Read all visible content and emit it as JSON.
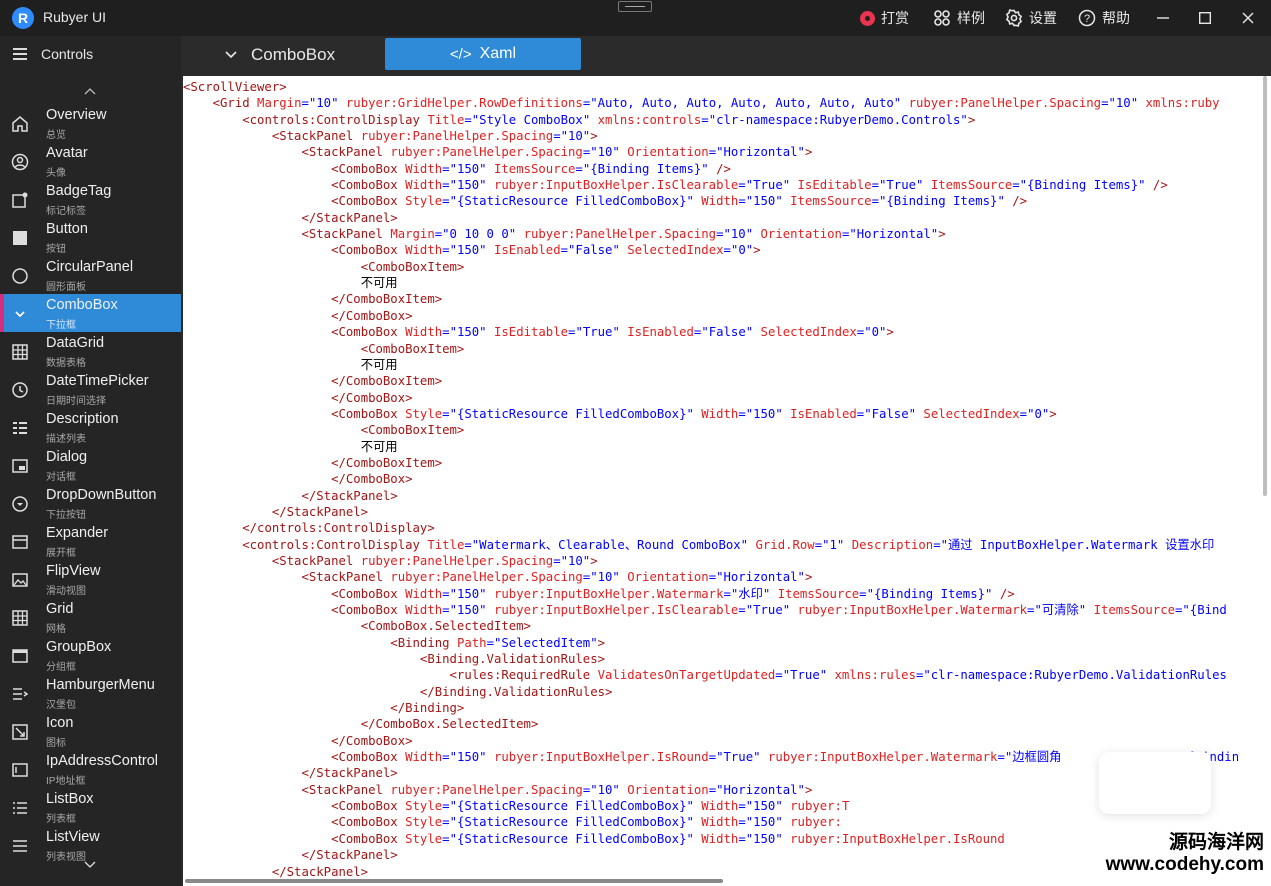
{
  "window": {
    "title": "Rubyer UI",
    "logo_letter": "R",
    "toolbar": [
      {
        "key": "reward",
        "label": "打赏",
        "icon": "reward-icon"
      },
      {
        "key": "samples",
        "label": "样例",
        "icon": "grid-icon"
      },
      {
        "key": "settings",
        "label": "设置",
        "icon": "gear-icon"
      },
      {
        "key": "help",
        "label": "帮助",
        "icon": "help-icon"
      }
    ],
    "controls": {
      "minimize": "—",
      "maximize": "☐",
      "close": "✕"
    }
  },
  "sidebar": {
    "header": "Controls",
    "items": [
      {
        "title": "Overview",
        "sub": "总览",
        "icon": "home-icon"
      },
      {
        "title": "Avatar",
        "sub": "头像",
        "icon": "avatar-icon"
      },
      {
        "title": "BadgeTag",
        "sub": "标记标签",
        "icon": "badge-icon"
      },
      {
        "title": "Button",
        "sub": "按钮",
        "icon": "button-icon"
      },
      {
        "title": "CircularPanel",
        "sub": "圆形面板",
        "icon": "circle-icon"
      },
      {
        "title": "ComboBox",
        "sub": "下拉框",
        "icon": "chevron-down-icon",
        "active": true
      },
      {
        "title": "DataGrid",
        "sub": "数据表格",
        "icon": "table-icon"
      },
      {
        "title": "DateTimePicker",
        "sub": "日期时间选择",
        "icon": "clock-icon"
      },
      {
        "title": "Description",
        "sub": "描述列表",
        "icon": "list-icon"
      },
      {
        "title": "Dialog",
        "sub": "对话框",
        "icon": "dialog-icon"
      },
      {
        "title": "DropDownButton",
        "sub": "下拉按钮",
        "icon": "dropdown-icon"
      },
      {
        "title": "Expander",
        "sub": "展开框",
        "icon": "expander-icon"
      },
      {
        "title": "FlipView",
        "sub": "滑动视图",
        "icon": "image-icon"
      },
      {
        "title": "Grid",
        "sub": "网格",
        "icon": "grid-icon"
      },
      {
        "title": "GroupBox",
        "sub": "分组框",
        "icon": "groupbox-icon"
      },
      {
        "title": "HamburgerMenu",
        "sub": "汉堡包",
        "icon": "menu-icon"
      },
      {
        "title": "Icon",
        "sub": "图标",
        "icon": "icon-icon"
      },
      {
        "title": "IpAddressControl",
        "sub": "IP地址框",
        "icon": "ip-icon"
      },
      {
        "title": "ListBox",
        "sub": "列表框",
        "icon": "listbox-icon"
      },
      {
        "title": "ListView",
        "sub": "列表视图",
        "icon": "listview-icon"
      }
    ]
  },
  "tabs": {
    "combo_label": "ComboBox",
    "xaml_label": "Xaml",
    "xaml_icon": "</>"
  },
  "code": [
    [
      [
        "t",
        "<ScrollViewer>"
      ]
    ],
    [
      [
        "s",
        "    "
      ],
      [
        "t",
        "<Grid "
      ],
      [
        "a",
        "Margin"
      ],
      [
        "p",
        "="
      ],
      [
        "v",
        "\"10\" "
      ],
      [
        "a",
        "rubyer:GridHelper.RowDefinitions"
      ],
      [
        "p",
        "="
      ],
      [
        "v",
        "\"Auto, Auto, Auto, Auto, Auto, Auto, Auto\" "
      ],
      [
        "a",
        "rubyer:PanelHelper.Spacing"
      ],
      [
        "p",
        "="
      ],
      [
        "v",
        "\"10\" "
      ],
      [
        "a",
        "xmlns:ruby"
      ]
    ],
    [
      [
        "s",
        "        "
      ],
      [
        "t",
        "<controls:ControlDisplay "
      ],
      [
        "a",
        "Title"
      ],
      [
        "p",
        "="
      ],
      [
        "v",
        "\"Style ComboBox\" "
      ],
      [
        "a",
        "xmlns:controls"
      ],
      [
        "p",
        "="
      ],
      [
        "v",
        "\"clr-namespace:RubyerDemo.Controls\""
      ],
      [
        "t",
        ">"
      ]
    ],
    [
      [
        "s",
        "            "
      ],
      [
        "t",
        "<StackPanel "
      ],
      [
        "a",
        "rubyer:PanelHelper.Spacing"
      ],
      [
        "p",
        "="
      ],
      [
        "v",
        "\"10\""
      ],
      [
        "t",
        ">"
      ]
    ],
    [
      [
        "s",
        "                "
      ],
      [
        "t",
        "<StackPanel "
      ],
      [
        "a",
        "rubyer:PanelHelper.Spacing"
      ],
      [
        "p",
        "="
      ],
      [
        "v",
        "\"10\" "
      ],
      [
        "a",
        "Orientation"
      ],
      [
        "p",
        "="
      ],
      [
        "v",
        "\"Horizontal\""
      ],
      [
        "t",
        ">"
      ]
    ],
    [
      [
        "s",
        "                    "
      ],
      [
        "t",
        "<ComboBox "
      ],
      [
        "a",
        "Width"
      ],
      [
        "p",
        "="
      ],
      [
        "v",
        "\"150\" "
      ],
      [
        "a",
        "ItemsSource"
      ],
      [
        "p",
        "="
      ],
      [
        "v",
        "\"{Binding Items}\" "
      ],
      [
        "t",
        "/>"
      ]
    ],
    [
      [
        "s",
        "                    "
      ],
      [
        "t",
        "<ComboBox "
      ],
      [
        "a",
        "Width"
      ],
      [
        "p",
        "="
      ],
      [
        "v",
        "\"150\" "
      ],
      [
        "a",
        "rubyer:InputBoxHelper.IsClearable"
      ],
      [
        "p",
        "="
      ],
      [
        "v",
        "\"True\" "
      ],
      [
        "a",
        "IsEditable"
      ],
      [
        "p",
        "="
      ],
      [
        "v",
        "\"True\" "
      ],
      [
        "a",
        "ItemsSource"
      ],
      [
        "p",
        "="
      ],
      [
        "v",
        "\"{Binding Items}\" "
      ],
      [
        "t",
        "/>"
      ]
    ],
    [
      [
        "s",
        "                    "
      ],
      [
        "t",
        "<ComboBox "
      ],
      [
        "a",
        "Style"
      ],
      [
        "p",
        "="
      ],
      [
        "v",
        "\"{StaticResource FilledComboBox}\" "
      ],
      [
        "a",
        "Width"
      ],
      [
        "p",
        "="
      ],
      [
        "v",
        "\"150\" "
      ],
      [
        "a",
        "ItemsSource"
      ],
      [
        "p",
        "="
      ],
      [
        "v",
        "\"{Binding Items}\" "
      ],
      [
        "t",
        "/>"
      ]
    ],
    [
      [
        "s",
        "                "
      ],
      [
        "t",
        "</StackPanel>"
      ]
    ],
    [
      [
        "s",
        "                "
      ],
      [
        "t",
        "<StackPanel "
      ],
      [
        "a",
        "Margin"
      ],
      [
        "p",
        "="
      ],
      [
        "v",
        "\"0 10 0 0\" "
      ],
      [
        "a",
        "rubyer:PanelHelper.Spacing"
      ],
      [
        "p",
        "="
      ],
      [
        "v",
        "\"10\" "
      ],
      [
        "a",
        "Orientation"
      ],
      [
        "p",
        "="
      ],
      [
        "v",
        "\"Horizontal\""
      ],
      [
        "t",
        ">"
      ]
    ],
    [
      [
        "s",
        "                    "
      ],
      [
        "t",
        "<ComboBox "
      ],
      [
        "a",
        "Width"
      ],
      [
        "p",
        "="
      ],
      [
        "v",
        "\"150\" "
      ],
      [
        "a",
        "IsEnabled"
      ],
      [
        "p",
        "="
      ],
      [
        "v",
        "\"False\" "
      ],
      [
        "a",
        "SelectedIndex"
      ],
      [
        "p",
        "="
      ],
      [
        "v",
        "\"0\""
      ],
      [
        "t",
        ">"
      ]
    ],
    [
      [
        "s",
        "                        "
      ],
      [
        "t",
        "<ComboBoxItem>"
      ]
    ],
    [
      [
        "s",
        "                        "
      ],
      [
        "x",
        "不可用"
      ]
    ],
    [
      [
        "s",
        "                    "
      ],
      [
        "t",
        "</ComboBoxItem>"
      ]
    ],
    [
      [
        "s",
        "                    "
      ],
      [
        "t",
        "</ComboBox>"
      ]
    ],
    [
      [
        "s",
        "                    "
      ],
      [
        "t",
        "<ComboBox "
      ],
      [
        "a",
        "Width"
      ],
      [
        "p",
        "="
      ],
      [
        "v",
        "\"150\" "
      ],
      [
        "a",
        "IsEditable"
      ],
      [
        "p",
        "="
      ],
      [
        "v",
        "\"True\" "
      ],
      [
        "a",
        "IsEnabled"
      ],
      [
        "p",
        "="
      ],
      [
        "v",
        "\"False\" "
      ],
      [
        "a",
        "SelectedIndex"
      ],
      [
        "p",
        "="
      ],
      [
        "v",
        "\"0\""
      ],
      [
        "t",
        ">"
      ]
    ],
    [
      [
        "s",
        "                        "
      ],
      [
        "t",
        "<ComboBoxItem>"
      ]
    ],
    [
      [
        "s",
        "                        "
      ],
      [
        "x",
        "不可用"
      ]
    ],
    [
      [
        "s",
        "                    "
      ],
      [
        "t",
        "</ComboBoxItem>"
      ]
    ],
    [
      [
        "s",
        "                    "
      ],
      [
        "t",
        "</ComboBox>"
      ]
    ],
    [
      [
        "s",
        "                    "
      ],
      [
        "t",
        "<ComboBox "
      ],
      [
        "a",
        "Style"
      ],
      [
        "p",
        "="
      ],
      [
        "v",
        "\"{StaticResource FilledComboBox}\" "
      ],
      [
        "a",
        "Width"
      ],
      [
        "p",
        "="
      ],
      [
        "v",
        "\"150\" "
      ],
      [
        "a",
        "IsEnabled"
      ],
      [
        "p",
        "="
      ],
      [
        "v",
        "\"False\" "
      ],
      [
        "a",
        "SelectedIndex"
      ],
      [
        "p",
        "="
      ],
      [
        "v",
        "\"0\""
      ],
      [
        "t",
        ">"
      ]
    ],
    [
      [
        "s",
        "                        "
      ],
      [
        "t",
        "<ComboBoxItem>"
      ]
    ],
    [
      [
        "s",
        "                        "
      ],
      [
        "x",
        "不可用"
      ]
    ],
    [
      [
        "s",
        "                    "
      ],
      [
        "t",
        "</ComboBoxItem>"
      ]
    ],
    [
      [
        "s",
        "                    "
      ],
      [
        "t",
        "</ComboBox>"
      ]
    ],
    [
      [
        "s",
        "                "
      ],
      [
        "t",
        "</StackPanel>"
      ]
    ],
    [
      [
        "s",
        "            "
      ],
      [
        "t",
        "</StackPanel>"
      ]
    ],
    [
      [
        "s",
        "        "
      ],
      [
        "t",
        "</controls:ControlDisplay>"
      ]
    ],
    [
      [
        "s",
        "        "
      ],
      [
        "t",
        "<controls:ControlDisplay "
      ],
      [
        "a",
        "Title"
      ],
      [
        "p",
        "="
      ],
      [
        "v",
        "\"Watermark、Clearable、Round ComboBox\" "
      ],
      [
        "a",
        "Grid.Row"
      ],
      [
        "p",
        "="
      ],
      [
        "v",
        "\"1\" "
      ],
      [
        "a",
        "Description"
      ],
      [
        "p",
        "="
      ],
      [
        "v",
        "\"通过 InputBoxHelper.Watermark 设置水印"
      ]
    ],
    [
      [
        "s",
        "            "
      ],
      [
        "t",
        "<StackPanel "
      ],
      [
        "a",
        "rubyer:PanelHelper.Spacing"
      ],
      [
        "p",
        "="
      ],
      [
        "v",
        "\"10\""
      ],
      [
        "t",
        ">"
      ]
    ],
    [
      [
        "s",
        "                "
      ],
      [
        "t",
        "<StackPanel "
      ],
      [
        "a",
        "rubyer:PanelHelper.Spacing"
      ],
      [
        "p",
        "="
      ],
      [
        "v",
        "\"10\" "
      ],
      [
        "a",
        "Orientation"
      ],
      [
        "p",
        "="
      ],
      [
        "v",
        "\"Horizontal\""
      ],
      [
        "t",
        ">"
      ]
    ],
    [
      [
        "s",
        "                    "
      ],
      [
        "t",
        "<ComboBox "
      ],
      [
        "a",
        "Width"
      ],
      [
        "p",
        "="
      ],
      [
        "v",
        "\"150\" "
      ],
      [
        "a",
        "rubyer:InputBoxHelper.Watermark"
      ],
      [
        "p",
        "="
      ],
      [
        "v",
        "\"水印\" "
      ],
      [
        "a",
        "ItemsSource"
      ],
      [
        "p",
        "="
      ],
      [
        "v",
        "\"{Binding Items}\" "
      ],
      [
        "t",
        "/>"
      ]
    ],
    [
      [
        "s",
        "                    "
      ],
      [
        "t",
        "<ComboBox "
      ],
      [
        "a",
        "Width"
      ],
      [
        "p",
        "="
      ],
      [
        "v",
        "\"150\" "
      ],
      [
        "a",
        "rubyer:InputBoxHelper.IsClearable"
      ],
      [
        "p",
        "="
      ],
      [
        "v",
        "\"True\" "
      ],
      [
        "a",
        "rubyer:InputBoxHelper.Watermark"
      ],
      [
        "p",
        "="
      ],
      [
        "v",
        "\"可清除\" "
      ],
      [
        "a",
        "ItemsSource"
      ],
      [
        "p",
        "="
      ],
      [
        "v",
        "\"{Bind"
      ]
    ],
    [
      [
        "s",
        "                        "
      ],
      [
        "t",
        "<ComboBox.SelectedItem>"
      ]
    ],
    [
      [
        "s",
        "                            "
      ],
      [
        "t",
        "<Binding "
      ],
      [
        "a",
        "Path"
      ],
      [
        "p",
        "="
      ],
      [
        "v",
        "\"SelectedItem\""
      ],
      [
        "t",
        ">"
      ]
    ],
    [
      [
        "s",
        "                                "
      ],
      [
        "t",
        "<Binding.ValidationRules>"
      ]
    ],
    [
      [
        "s",
        "                                    "
      ],
      [
        "t",
        "<rules:RequiredRule "
      ],
      [
        "a",
        "ValidatesOnTargetUpdated"
      ],
      [
        "p",
        "="
      ],
      [
        "v",
        "\"True\" "
      ],
      [
        "a",
        "xmlns:rules"
      ],
      [
        "p",
        "="
      ],
      [
        "v",
        "\"clr-namespace:RubyerDemo.ValidationRules"
      ]
    ],
    [
      [
        "s",
        "                                "
      ],
      [
        "t",
        "</Binding.ValidationRules>"
      ]
    ],
    [
      [
        "s",
        "                            "
      ],
      [
        "t",
        "</Binding>"
      ]
    ],
    [
      [
        "s",
        "                        "
      ],
      [
        "t",
        "</ComboBox.SelectedItem>"
      ]
    ],
    [
      [
        "s",
        "                    "
      ],
      [
        "t",
        "</ComboBox>"
      ]
    ],
    [
      [
        "s",
        "                    "
      ],
      [
        "t",
        "<ComboBox "
      ],
      [
        "a",
        "Width"
      ],
      [
        "p",
        "="
      ],
      [
        "v",
        "\"150\" "
      ],
      [
        "a",
        "rubyer:InputBoxHelper.IsRound"
      ],
      [
        "p",
        "="
      ],
      [
        "v",
        "\"True\" "
      ],
      [
        "a",
        "rubyer:InputBoxHelper.Watermark"
      ],
      [
        "p",
        "="
      ],
      [
        "v",
        "\"边框圆角                \"{Bindin"
      ]
    ],
    [
      [
        "s",
        "                "
      ],
      [
        "t",
        "</StackPanel>"
      ]
    ],
    [
      [
        "s",
        "                "
      ],
      [
        "t",
        "<StackPanel "
      ],
      [
        "a",
        "rubyer:PanelHelper.Spacing"
      ],
      [
        "p",
        "="
      ],
      [
        "v",
        "\"10\" "
      ],
      [
        "a",
        "Orientation"
      ],
      [
        "p",
        "="
      ],
      [
        "v",
        "\"Horizontal\""
      ],
      [
        "t",
        ">"
      ]
    ],
    [
      [
        "s",
        "                    "
      ],
      [
        "t",
        "<ComboBox "
      ],
      [
        "a",
        "Style"
      ],
      [
        "p",
        "="
      ],
      [
        "v",
        "\"{StaticResource FilledComboBox}\" "
      ],
      [
        "a",
        "Width"
      ],
      [
        "p",
        "="
      ],
      [
        "v",
        "\"150\" "
      ],
      [
        "a",
        "rubyer:T"
      ]
    ],
    [
      [
        "s",
        "                    "
      ],
      [
        "t",
        "<ComboBox "
      ],
      [
        "a",
        "Style"
      ],
      [
        "p",
        "="
      ],
      [
        "v",
        "\"{StaticResource FilledComboBox}\" "
      ],
      [
        "a",
        "Width"
      ],
      [
        "p",
        "="
      ],
      [
        "v",
        "\"150\" "
      ],
      [
        "a",
        "rubyer:"
      ]
    ],
    [
      [
        "s",
        "                    "
      ],
      [
        "t",
        "<ComboBox "
      ],
      [
        "a",
        "Style"
      ],
      [
        "p",
        "="
      ],
      [
        "v",
        "\"{StaticResource FilledComboBox}\" "
      ],
      [
        "a",
        "Width"
      ],
      [
        "p",
        "="
      ],
      [
        "v",
        "\"150\" "
      ],
      [
        "a",
        "rubyer:InputBoxHelper.IsRound"
      ]
    ],
    [
      [
        "s",
        "                "
      ],
      [
        "t",
        "</StackPanel>"
      ]
    ],
    [
      [
        "s",
        "            "
      ],
      [
        "t",
        "</StackPanel>"
      ]
    ]
  ],
  "watermark": {
    "line1": "源码海洋网",
    "line2": "www.codehy.com"
  }
}
